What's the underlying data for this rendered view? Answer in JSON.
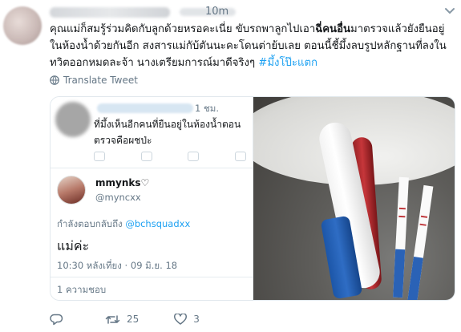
{
  "tweet": {
    "time": "10m",
    "text_part1": "คุณแม่ก็สมรู้ร่วมคิดกับลูกด้วยหรอคะเนี่ย ขับรถพาลูกไปเอา",
    "text_bold": "ฉี่คนอื่น",
    "text_part2": "มาตรวจแล้วยังยืนอยู่ในห้องน้ำด้วยกันอีก สงสารแม่กับ้ตันนะคะโดนต่าย้บเลย ตอนนี้ชี้มึ้งลบรูปหลักฐานที่ลงในทวิตออกหมดละจ้า นางเตรียมการณ์มาดีจริงๆ ",
    "hashtag": "#มึ้งโป๊ะแตก",
    "translate": "Translate Tweet",
    "replies": "",
    "retweets": "25",
    "likes": "3"
  },
  "screenshot": {
    "time": "1 ชม.",
    "quoted_text": "ที่มึ้งเห็นอีกคนที่ยืนอยู่ในห้องน้ำตอนตรวจคือผชป่ะ",
    "reply_name": "mmynks♡",
    "reply_handle": "@myncxx",
    "replying_to_label": "กำลังตอบกลับถึง ",
    "replying_to_handle": "@bchsquadxx",
    "reply_body": "แม่ค่ะ",
    "reply_time": "10:30 หลังเที่ยง · 09 มิ.ย. 18",
    "likes_label": "1 ความชอบ"
  },
  "colors": {
    "link": "#1da1f2",
    "muted": "#657786"
  },
  "icons": [
    "caret-down-icon",
    "globe-icon",
    "reply-icon",
    "retweet-icon",
    "heart-icon"
  ]
}
